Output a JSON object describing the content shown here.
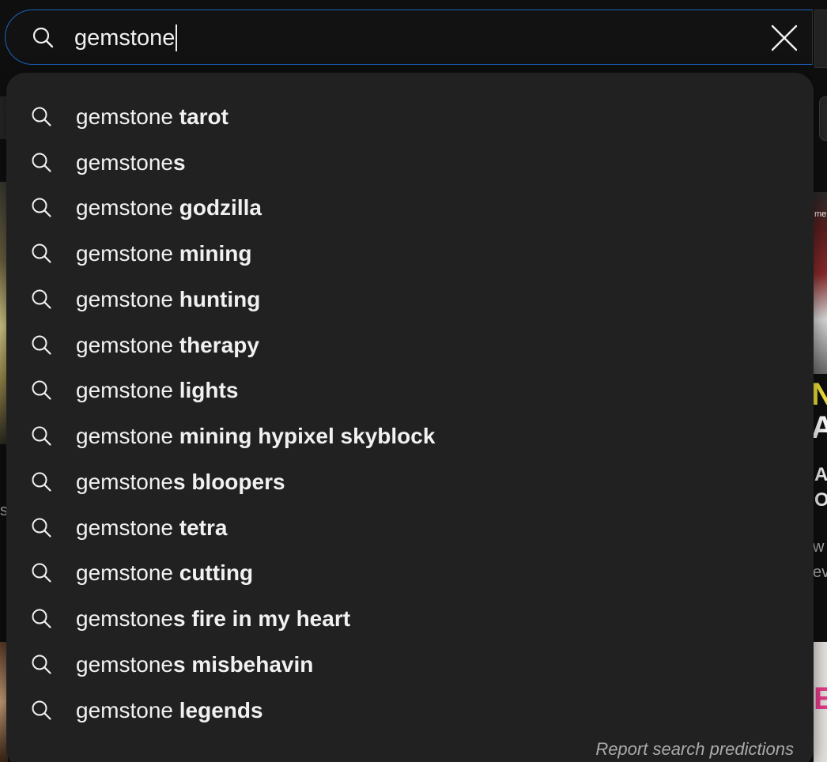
{
  "search": {
    "query": "gemstone",
    "clear_icon": "close-icon",
    "search_icon": "search-icon"
  },
  "suggestions": [
    {
      "base": "gemstone ",
      "completion": "tarot"
    },
    {
      "base": "gemstone",
      "completion": "s"
    },
    {
      "base": "gemstone ",
      "completion": "godzilla"
    },
    {
      "base": "gemstone ",
      "completion": "mining"
    },
    {
      "base": "gemstone ",
      "completion": "hunting"
    },
    {
      "base": "gemstone ",
      "completion": "therapy"
    },
    {
      "base": "gemstone ",
      "completion": "lights"
    },
    {
      "base": "gemstone ",
      "completion": "mining hypixel skyblock"
    },
    {
      "base": "gemstone",
      "completion": "s bloopers"
    },
    {
      "base": "gemstone ",
      "completion": "tetra"
    },
    {
      "base": "gemstone ",
      "completion": "cutting"
    },
    {
      "base": "gemstone",
      "completion": "s fire in my heart"
    },
    {
      "base": "gemstone",
      "completion": "s misbehavin"
    },
    {
      "base": "gemstone ",
      "completion": "legends"
    }
  ],
  "report_link": "Report search predictions",
  "background": {
    "left_fragment": "s",
    "right_thumb_text": "me",
    "right_big_1": "N",
    "right_big_2": "A",
    "right_title": "A\nOf",
    "right_meta": "w\nev",
    "right_pink_text": "E"
  },
  "colors": {
    "page_bg": "#0f0f0f",
    "dropdown_bg": "#212121",
    "focus_border": "#1c62b9",
    "text_primary": "#f1f1f1",
    "text_secondary": "#aaaaaa"
  }
}
